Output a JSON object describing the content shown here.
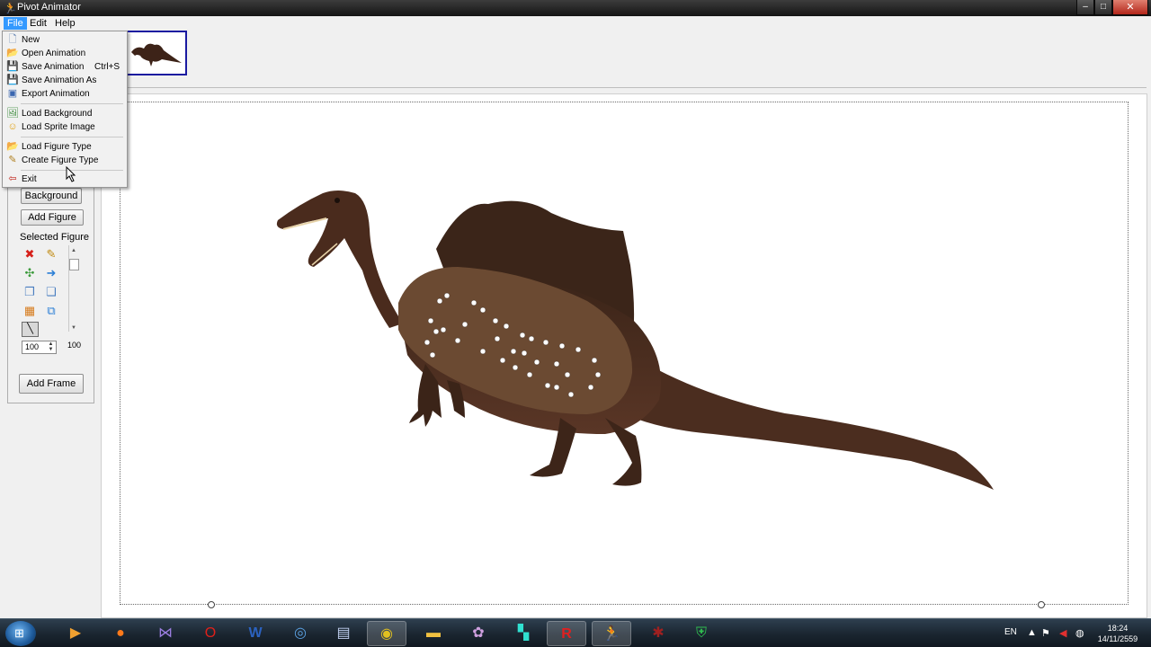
{
  "window": {
    "title": "Pivot Animator",
    "minimize": "–",
    "maximize": "□",
    "close": "✕"
  },
  "menubar": {
    "file": "File",
    "edit": "Edit",
    "help": "Help"
  },
  "file_menu": {
    "items": [
      {
        "label": "New",
        "icon": "new-file-icon",
        "shortcut": ""
      },
      {
        "label": "Open Animation",
        "icon": "open-animation-icon",
        "shortcut": ""
      },
      {
        "label": "Save Animation",
        "icon": "save-icon",
        "shortcut": "Ctrl+S"
      },
      {
        "label": "Save Animation As",
        "icon": "save-as-icon",
        "shortcut": ""
      },
      {
        "label": "Export Animation",
        "icon": "export-icon",
        "shortcut": ""
      },
      {
        "label": "Load Background",
        "icon": "load-background-icon",
        "shortcut": ""
      },
      {
        "label": "Load Sprite Image",
        "icon": "sprite-icon",
        "shortcut": ""
      },
      {
        "label": "Load Figure Type",
        "icon": "load-figure-icon",
        "shortcut": ""
      },
      {
        "label": "Create Figure Type",
        "icon": "pencil-icon",
        "shortcut": ""
      },
      {
        "label": "Exit",
        "icon": "exit-icon",
        "shortcut": ""
      }
    ]
  },
  "tool_panel": {
    "background_button": "Background",
    "add_figure_button": "Add Figure",
    "selected_figure_label": "Selected Figure",
    "size_value": "100",
    "size_max": "100",
    "add_frame_button": "Add Frame"
  },
  "taskbar": {
    "language": "EN",
    "time": "18:24",
    "date": "14/11/2559",
    "apps": [
      "explorer",
      "media-player",
      "firefox",
      "visual-studio",
      "opera",
      "word",
      "network-tool",
      "presentation",
      "chrome",
      "file-explorer",
      "paint",
      "game",
      "roblox",
      "pivot-animator",
      "spider-app",
      "security-shield"
    ]
  },
  "colors": {
    "accent": "#3399ff",
    "frame_border": "#1a1aa0",
    "dino_body": "#4a2c1e",
    "overlay_blob": "#6b4a32"
  }
}
